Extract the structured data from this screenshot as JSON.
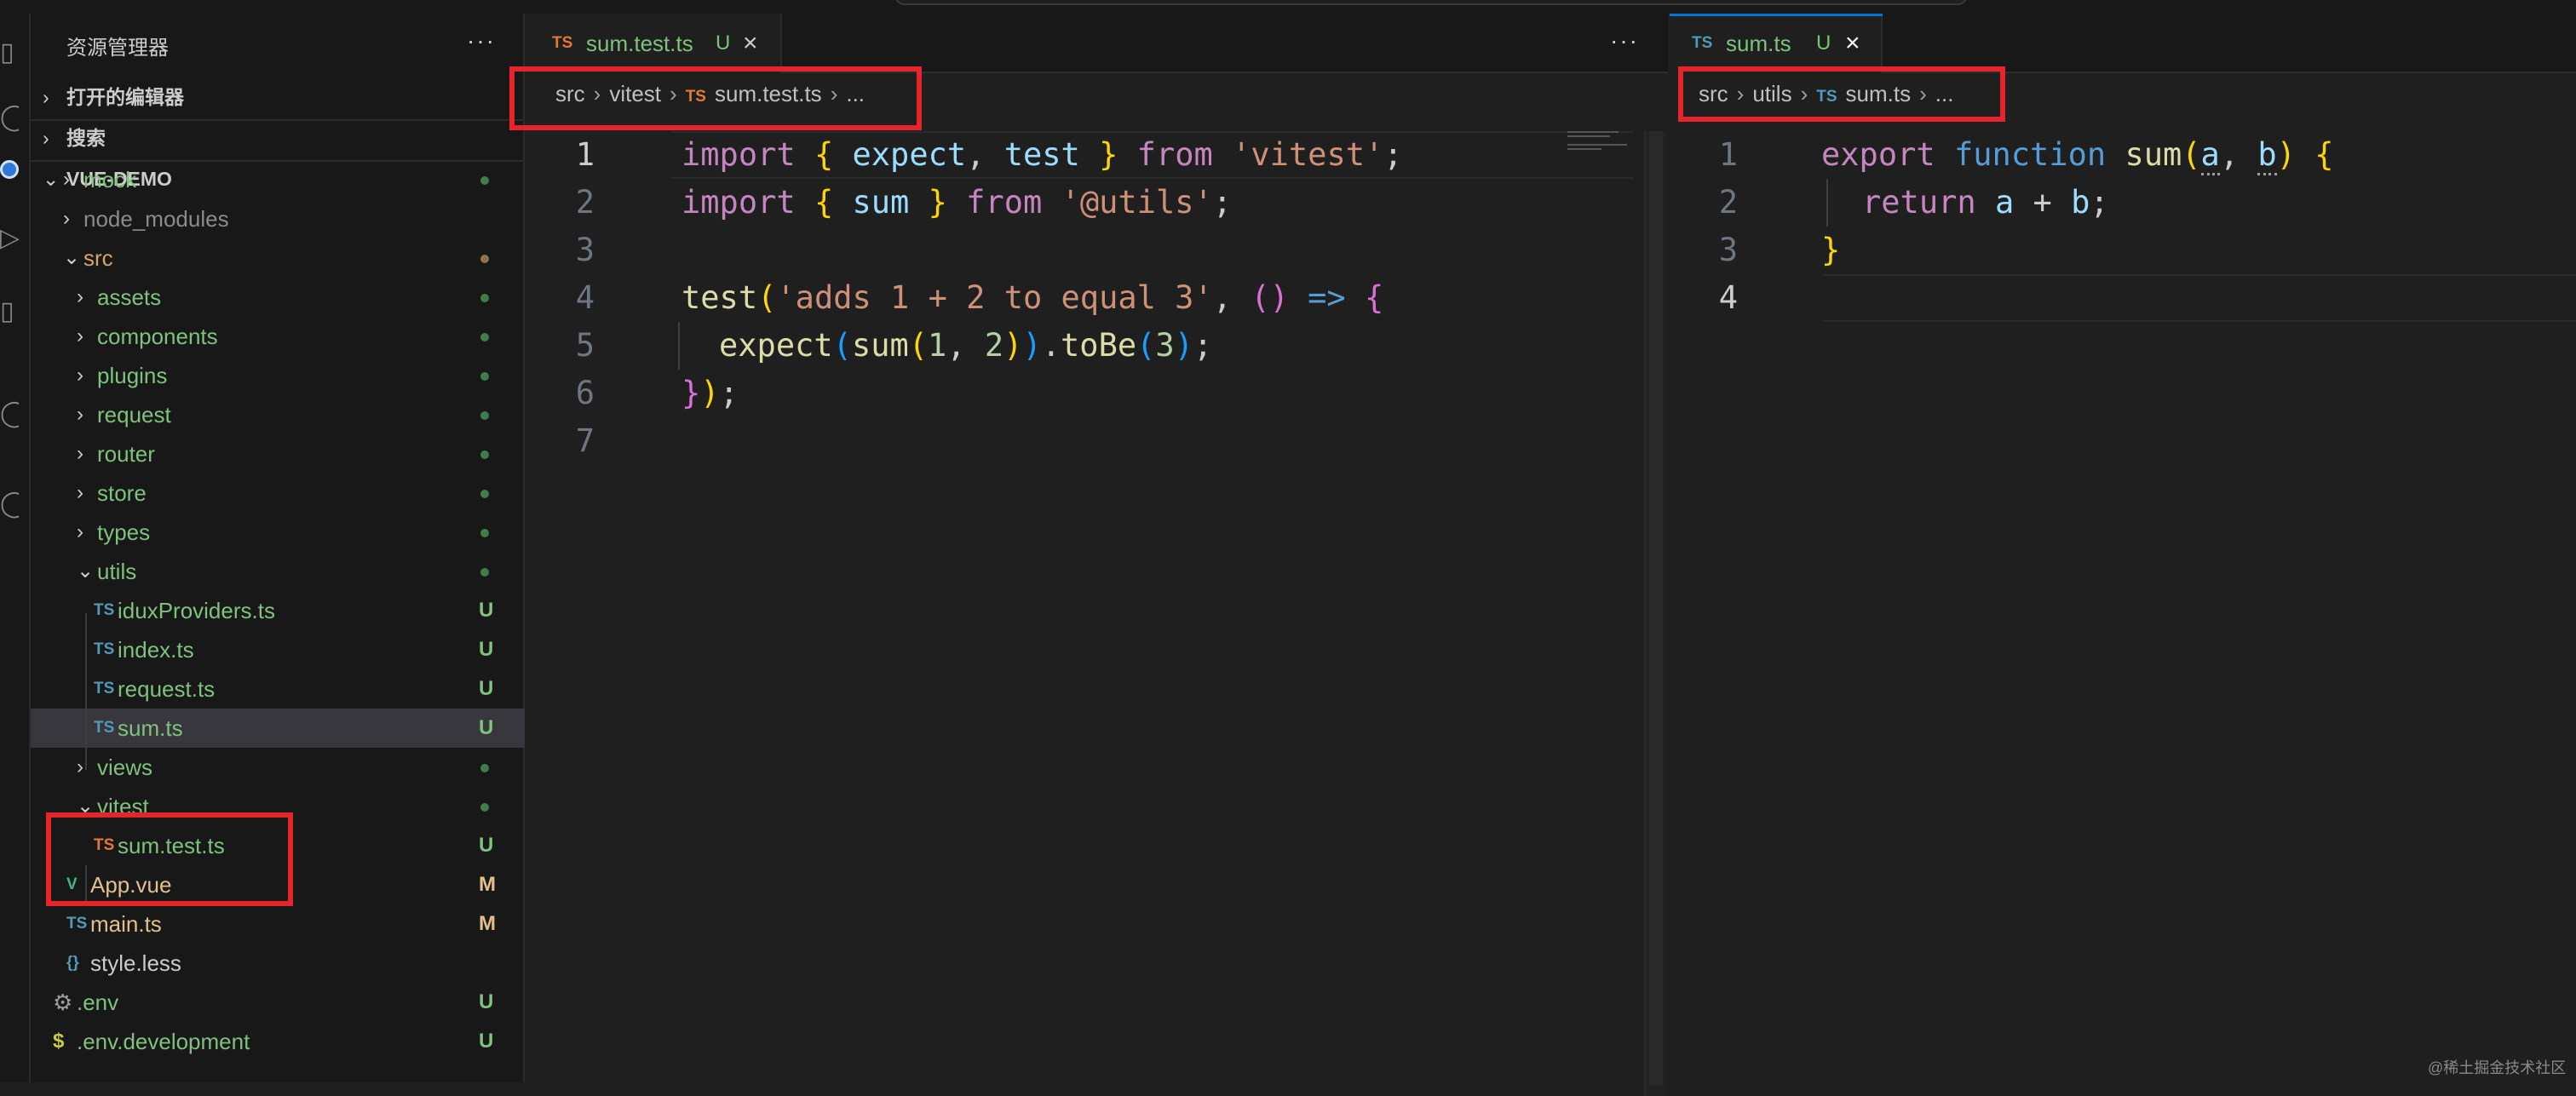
{
  "explorer": {
    "title": "资源管理器",
    "more": "···",
    "sections": {
      "open_editors": "打开的编辑器",
      "search": "搜索",
      "project": "VUE-DEMO"
    },
    "tree": [
      {
        "label": "mock",
        "kind": "folder",
        "status": "",
        "color": "#7ec27e"
      },
      {
        "label": "node_modules",
        "kind": "folder",
        "status": "",
        "color": "#8b8b8b"
      },
      {
        "label": "src",
        "kind": "folder-open",
        "status": "",
        "color": "#d7a56a"
      },
      {
        "label": "assets",
        "kind": "folder",
        "status": "",
        "color": "#7ec27e"
      },
      {
        "label": "components",
        "kind": "folder",
        "status": "",
        "color": "#7ec27e"
      },
      {
        "label": "plugins",
        "kind": "folder",
        "status": "",
        "color": "#7ec27e"
      },
      {
        "label": "request",
        "kind": "folder",
        "status": "",
        "color": "#7ec27e"
      },
      {
        "label": "router",
        "kind": "folder",
        "status": "",
        "color": "#7ec27e"
      },
      {
        "label": "store",
        "kind": "folder",
        "status": "",
        "color": "#7ec27e"
      },
      {
        "label": "types",
        "kind": "folder",
        "status": "",
        "color": "#7ec27e"
      },
      {
        "label": "utils",
        "kind": "folder-open",
        "status": "",
        "color": "#7ec27e"
      },
      {
        "label": "iduxProviders.ts",
        "kind": "ts",
        "status": "U",
        "color": "#7ec27e"
      },
      {
        "label": "index.ts",
        "kind": "ts",
        "status": "U",
        "color": "#7ec27e"
      },
      {
        "label": "request.ts",
        "kind": "ts",
        "status": "U",
        "color": "#7ec27e"
      },
      {
        "label": "sum.ts",
        "kind": "ts",
        "status": "U",
        "color": "#7ec27e"
      },
      {
        "label": "views",
        "kind": "folder",
        "status": "",
        "color": "#7ec27e"
      },
      {
        "label": "vitest",
        "kind": "folder-open",
        "status": "",
        "color": "#7ec27e"
      },
      {
        "label": "sum.test.ts",
        "kind": "ts",
        "status": "U",
        "color": "#7ec27e"
      },
      {
        "label": "App.vue",
        "kind": "vue",
        "status": "M",
        "color": "#e2c08d"
      },
      {
        "label": "main.ts",
        "kind": "ts",
        "status": "M",
        "color": "#e2c08d"
      },
      {
        "label": "style.less",
        "kind": "less",
        "status": "",
        "color": "#cccccc"
      },
      {
        "label": ".env",
        "kind": "gear",
        "status": "U",
        "color": "#7ec27e"
      },
      {
        "label": ".env.development",
        "kind": "dollar",
        "status": "U",
        "color": "#7ec27e"
      }
    ]
  },
  "left_editor": {
    "tab": {
      "icon": "TS",
      "name": "sum.test.ts",
      "status": "U",
      "close": "×"
    },
    "more": "···",
    "breadcrumb": [
      "src",
      "vitest",
      "sum.test.ts",
      "..."
    ],
    "line_numbers": [
      "1",
      "2",
      "3",
      "4",
      "5",
      "6",
      "7"
    ]
  },
  "right_editor": {
    "tab": {
      "icon": "TS",
      "name": "sum.ts",
      "status": "U",
      "close": "×"
    },
    "breadcrumb": [
      "src",
      "utils",
      "sum.ts",
      "..."
    ],
    "line_numbers": [
      "1",
      "2",
      "3",
      "4"
    ]
  },
  "code_tokens": {
    "import": "import",
    "expect": "expect",
    "test": "test",
    "from": "from",
    "vitest_str": "'vitest'",
    "sum": "sum",
    "utils_str": "'@utils'",
    "desc_str": "'adds 1 + 2 to equal 3'",
    "arrow": "=>",
    "one": "1",
    "two": "2",
    "three": "3",
    "toBe": "toBe",
    "export": "export",
    "function": "function",
    "a": "a",
    "b": "b",
    "return": "return",
    "plus": "+"
  },
  "watermark": "@稀土掘金技术社区",
  "colors": {
    "highlight_box": "#e5242b",
    "ts_icon": "#519aba",
    "ts_icon_test": "#e37933",
    "untracked": "#7ec27e",
    "modified": "#e2c08d"
  }
}
